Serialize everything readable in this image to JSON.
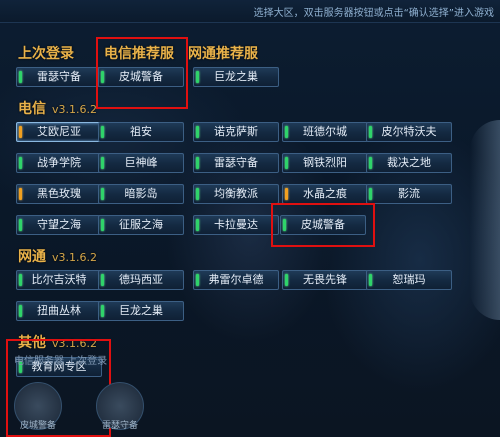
{
  "topbar": {
    "hint": "选择大区，双击服务器按钮或点击“确认选择”进入游戏"
  },
  "sections": {
    "recent": "上次登录",
    "telecom_rec": "电信推荐服",
    "netcom_rec": "网通推荐服",
    "telecom": "电信",
    "telecom_ver": "v3.1.6.2",
    "netcom": "网通",
    "netcom_ver": "v3.1.6.2",
    "other": "其他",
    "other_ver": "v3.1.6.2"
  },
  "recent_servers": [
    {
      "label": "雷瑟守备",
      "status": "green"
    }
  ],
  "telecom_recommended": [
    {
      "label": "皮城警备",
      "status": "green"
    }
  ],
  "netcom_recommended": [
    {
      "label": "巨龙之巢",
      "status": "green"
    }
  ],
  "telecom_servers": [
    {
      "label": "艾欧尼亚",
      "status": "orange"
    },
    {
      "label": "祖安",
      "status": "green"
    },
    {
      "label": "诺克萨斯",
      "status": "green"
    },
    {
      "label": "班德尔城",
      "status": "green"
    },
    {
      "label": "皮尔特沃夫",
      "status": "green"
    },
    {
      "label": "战争学院",
      "status": "green"
    },
    {
      "label": "巨神峰",
      "status": "green"
    },
    {
      "label": "雷瑟守备",
      "status": "green"
    },
    {
      "label": "钢铁烈阳",
      "status": "green"
    },
    {
      "label": "裁决之地",
      "status": "green"
    },
    {
      "label": "黑色玫瑰",
      "status": "orange"
    },
    {
      "label": "暗影岛",
      "status": "green"
    },
    {
      "label": "均衡教派",
      "status": "green"
    },
    {
      "label": "水晶之痕",
      "status": "orange"
    },
    {
      "label": "影流",
      "status": "green"
    },
    {
      "label": "守望之海",
      "status": "green"
    },
    {
      "label": "征服之海",
      "status": "green"
    },
    {
      "label": "卡拉曼达",
      "status": "green"
    },
    {
      "label": "皮城警备",
      "status": "green"
    }
  ],
  "netcom_servers": [
    {
      "label": "比尔吉沃特",
      "status": "green"
    },
    {
      "label": "德玛西亚",
      "status": "green"
    },
    {
      "label": "弗雷尔卓德",
      "status": "green"
    },
    {
      "label": "无畏先锋",
      "status": "green"
    },
    {
      "label": "恕瑞玛",
      "status": "green"
    },
    {
      "label": "扭曲丛林",
      "status": "green"
    },
    {
      "label": "巨龙之巢",
      "status": "green"
    }
  ],
  "other_servers": [
    {
      "label": "教育网专区",
      "status": "green"
    }
  ],
  "bottom": {
    "tabs_faded": "电信服务器    上次登录",
    "emblem1": "皮城警备",
    "emblem2": "雷瑟守备"
  },
  "colors": {
    "accent": "#e9b24a",
    "highlight": "#e01010",
    "online": "#2fd36a",
    "busy": "#f0a020"
  }
}
